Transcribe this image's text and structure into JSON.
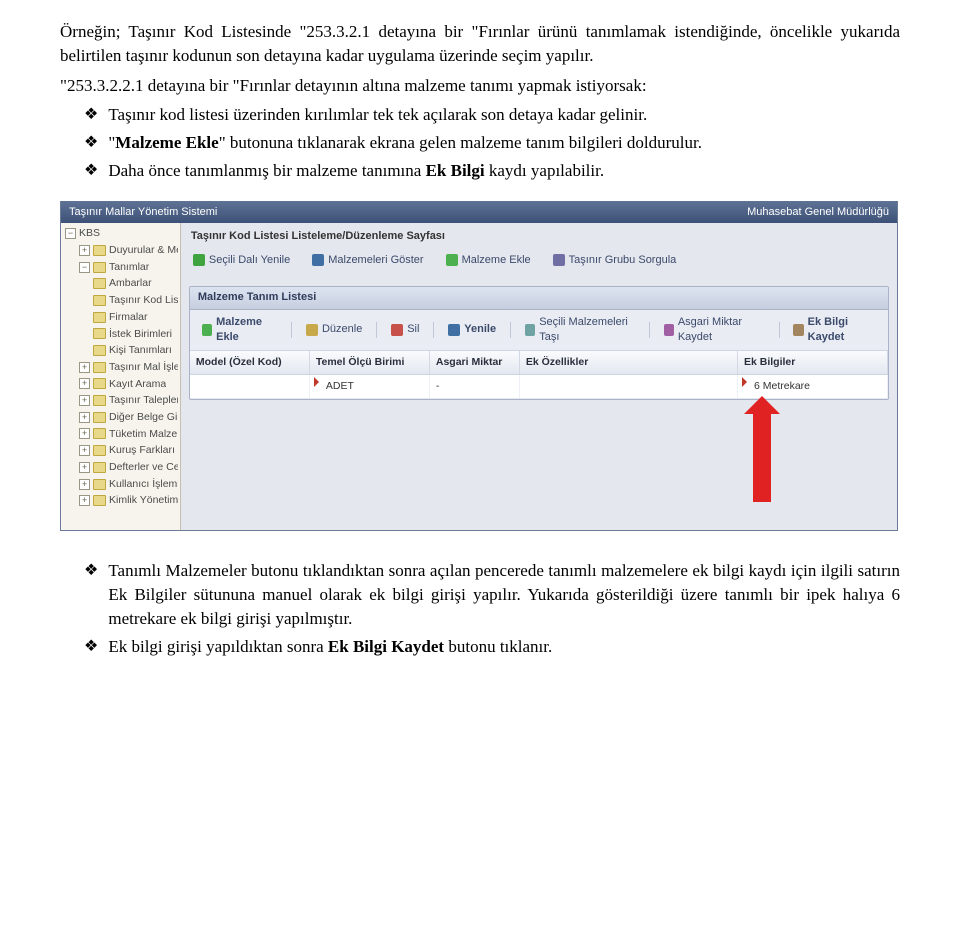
{
  "para1": "Örneğin; Taşınır Kod Listesinde \"253.3.2.1 detayına bir \"Fırınlar ürünü tanımlamak istendiğinde, öncelikle yukarıda belirtilen taşınır kodunun son detayına kadar uygulama üzerinde seçim yapılır.",
  "para2": "\"253.3.2.2.1 detayına bir \"Fırınlar detayının altına malzeme tanımı yapmak istiyorsak:",
  "bullets_top": [
    "Taşınır kod listesi üzerinden kırılımlar tek tek açılarak son detaya kadar gelinir.",
    "\"Malzeme Ekle\" butonuna tıklanarak ekrana gelen malzeme tanım bilgileri doldurulur.",
    "Daha önce tanımlanmış bir malzeme tanımına Ek Bilgi kaydı yapılabilir."
  ],
  "app": {
    "title_left": "Taşınır Mallar Yönetim Sistemi",
    "title_right": "Muhasebat Genel Müdürlüğü",
    "tree_root": "KBS",
    "tree": [
      "Duyurular & Mesajlar",
      "Tanımlar"
    ],
    "tree_tanimlar": [
      "Ambarlar",
      "Taşınır Kod Lis",
      "Firmalar",
      "İstek Birimleri",
      "Kişi Tanımları"
    ],
    "tree_after": [
      "Taşınır Mal İşlemle",
      "Kayıt Arama",
      "Taşınır Talepleri",
      "Diğer Belge Girişle",
      "Tüketim Malzeme",
      "Kuruş Farkları Rap",
      "Defterler ve Cetv",
      "Kullanıcı İşlemleri",
      "Kimlik Yönetimi"
    ],
    "page_title": "Taşınır Kod Listesi Listeleme/Düzenleme Sayfası",
    "toolbar1": [
      "Seçili Dalı Yenile",
      "Malzemeleri Göster",
      "Malzeme Ekle",
      "Taşınır Grubu Sorgula"
    ],
    "subtitle": "",
    "panel_head": "Malzeme Tanım Listesi",
    "toolbar2": [
      "Malzeme Ekle",
      "Düzenle",
      "Sil",
      "Yenile",
      "Seçili Malzemeleri Taşı",
      "Asgari Miktar Kaydet",
      "Ek Bilgi Kaydet"
    ],
    "columns": {
      "model": "Model (Özel Kod)",
      "olcu": "Temel Ölçü Birimi",
      "asgari": "Asgari Miktar",
      "ozel": "Ek Özellikler",
      "ekb": "Ek Bilgiler"
    },
    "row": {
      "model": "",
      "olcu": "ADET",
      "asgari": "-",
      "ozel": "",
      "ekb": "6 Metrekare"
    }
  },
  "bullets_bottom": [
    "Tanımlı Malzemeler butonu tıklandıktan sonra açılan pencerede tanımlı malzemelere ek bilgi kaydı için ilgili satırın Ek Bilgiler sütununa manuel olarak ek bilgi girişi yapılır. Yukarıda gösterildiği üzere tanımlı bir ipek halıya 6 metrekare ek bilgi girişi yapılmıştır.",
    "Ek bilgi girişi yapıldıktan sonra Ek Bilgi Kaydet butonu tıklanır."
  ]
}
